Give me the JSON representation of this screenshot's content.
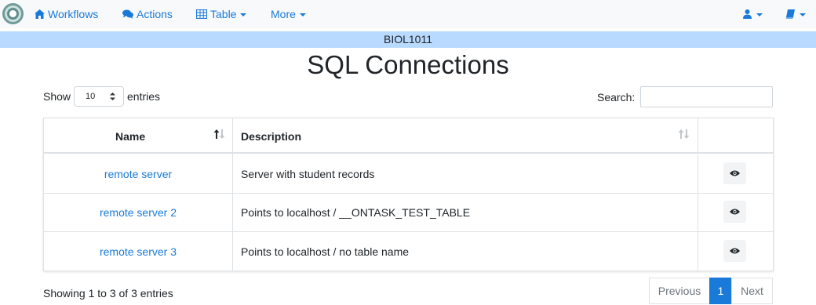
{
  "navbar": {
    "items": [
      {
        "label": "Workflows",
        "icon": "home-icon"
      },
      {
        "label": "Actions",
        "icon": "comments-icon"
      },
      {
        "label": "Table",
        "icon": "table-icon"
      },
      {
        "label": "More"
      }
    ],
    "user_icon": "user-icon",
    "docs_icon": "book-icon",
    "link_color": "#1a7ad9"
  },
  "course": {
    "name": "BIOL1011"
  },
  "page": {
    "title": "SQL Connections"
  },
  "controls": {
    "show_label": "Show",
    "entries_value": "10",
    "entries_label": "entries",
    "search_label": "Search:",
    "search_value": ""
  },
  "table": {
    "columns": [
      "Name",
      "Description",
      ""
    ],
    "rows": [
      {
        "name": "remote server",
        "description": "Server with student records"
      },
      {
        "name": "remote server 2",
        "description": "Points to localhost / __ONTASK_TEST_TABLE"
      },
      {
        "name": "remote server 3",
        "description": "Points to localhost / no table name"
      }
    ]
  },
  "footer": {
    "info": "Showing 1 to 3 of 3 entries",
    "pagination": {
      "previous": "Previous",
      "current": "1",
      "next": "Next"
    }
  }
}
